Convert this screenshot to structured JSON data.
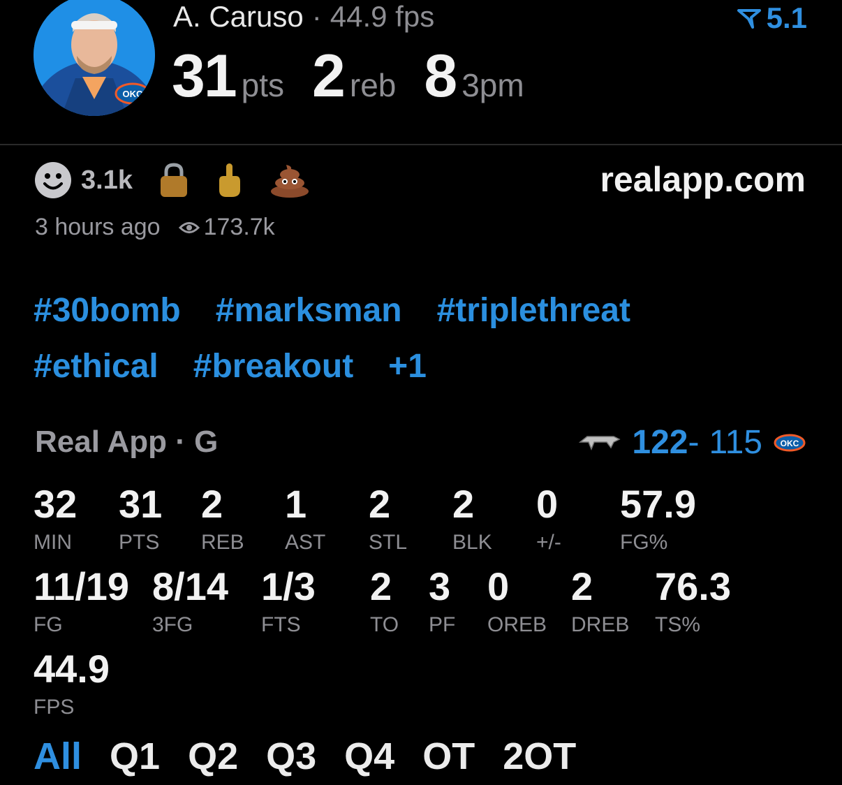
{
  "header": {
    "player_name": "A. Caruso",
    "separator": "·",
    "fps_text": "44.9 fps",
    "rating": "5.1",
    "stats": [
      {
        "value": "31",
        "unit": "pts"
      },
      {
        "value": "2",
        "unit": "reb"
      },
      {
        "value": "8",
        "unit": "3pm"
      }
    ]
  },
  "avatar": {
    "team_badge": "OKC"
  },
  "reactions": {
    "smile_count": "3.1k",
    "icons": [
      "smile-icon",
      "lock-icon",
      "finger-icon",
      "poop-icon"
    ]
  },
  "site": "realapp.com",
  "meta": {
    "time_ago": "3 hours ago",
    "views": "173.7k"
  },
  "tags": {
    "row1": [
      "#30bomb",
      "#marksman",
      "#triplethreat"
    ],
    "row2": [
      "#ethical",
      "#breakout",
      "+1"
    ]
  },
  "game": {
    "title": "Real App · G",
    "score_left": "122",
    "score_dash": "-",
    "score_right": "115",
    "right_team_badge": "OKC"
  },
  "box": {
    "row1": [
      {
        "v": "32",
        "l": "MIN"
      },
      {
        "v": "31",
        "l": "PTS"
      },
      {
        "v": "2",
        "l": "REB"
      },
      {
        "v": "1",
        "l": "AST"
      },
      {
        "v": "2",
        "l": "STL"
      },
      {
        "v": "2",
        "l": "BLK"
      },
      {
        "v": "0",
        "l": "+/-"
      },
      {
        "v": "57.9",
        "l": "FG%"
      }
    ],
    "row2": [
      {
        "v": "11/19",
        "l": "FG"
      },
      {
        "v": "8/14",
        "l": "3FG"
      },
      {
        "v": "1/3",
        "l": "FTS"
      },
      {
        "v": "2",
        "l": "TO"
      },
      {
        "v": "3",
        "l": "PF"
      },
      {
        "v": "0",
        "l": "OREB"
      },
      {
        "v": "2",
        "l": "DREB"
      },
      {
        "v": "76.3",
        "l": "TS%"
      }
    ],
    "row3": [
      {
        "v": "44.9",
        "l": "FPS"
      }
    ]
  },
  "quarters": {
    "tabs": [
      "All",
      "Q1",
      "Q2",
      "Q3",
      "Q4",
      "OT",
      "2OT"
    ],
    "active": "All"
  },
  "colors": {
    "accent": "#2f8fe0",
    "background": "#000000",
    "muted": "#8e8e93"
  }
}
